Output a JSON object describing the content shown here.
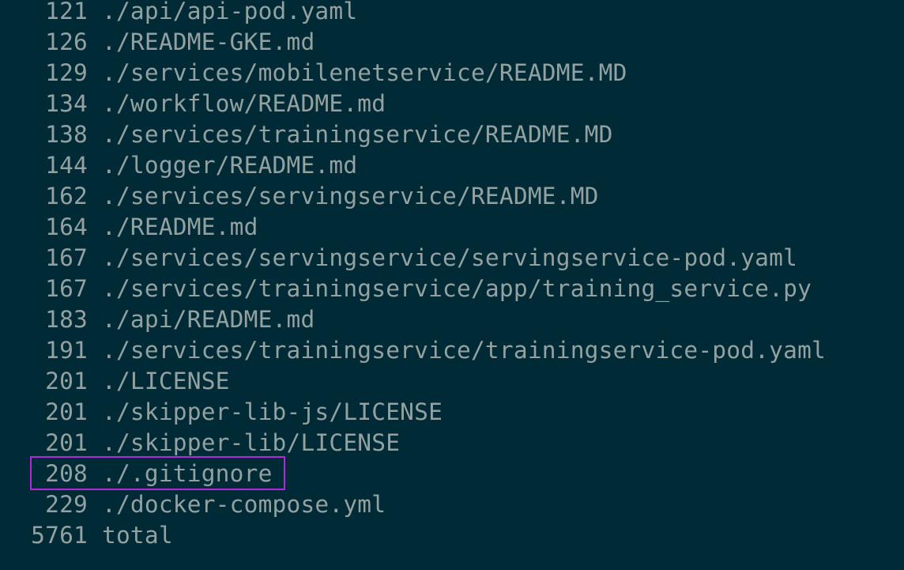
{
  "terminal": {
    "lines": [
      {
        "count": "121",
        "path": "./api/api-pod.yaml"
      },
      {
        "count": "126",
        "path": "./README-GKE.md"
      },
      {
        "count": "129",
        "path": "./services/mobilenetservice/README.MD"
      },
      {
        "count": "134",
        "path": "./workflow/README.md"
      },
      {
        "count": "138",
        "path": "./services/trainingservice/README.MD"
      },
      {
        "count": "144",
        "path": "./logger/README.md"
      },
      {
        "count": "162",
        "path": "./services/servingservice/README.MD"
      },
      {
        "count": "164",
        "path": "./README.md"
      },
      {
        "count": "167",
        "path": "./services/servingservice/servingservice-pod.yaml"
      },
      {
        "count": "167",
        "path": "./services/trainingservice/app/training_service.py"
      },
      {
        "count": "183",
        "path": "./api/README.md"
      },
      {
        "count": "191",
        "path": "./services/trainingservice/trainingservice-pod.yaml"
      },
      {
        "count": "201",
        "path": "./LICENSE"
      },
      {
        "count": "201",
        "path": "./skipper-lib-js/LICENSE"
      },
      {
        "count": "201",
        "path": "./skipper-lib/LICENSE"
      },
      {
        "count": "208",
        "path": "./.gitignore"
      },
      {
        "count": "229",
        "path": "./docker-compose.yml"
      },
      {
        "count": "5761",
        "path": "total"
      }
    ],
    "highlighted_line": "./.gitignore",
    "colors": {
      "background": "#002b36",
      "text": "#93a1a1",
      "highlight_border": "#b12ad8"
    }
  }
}
